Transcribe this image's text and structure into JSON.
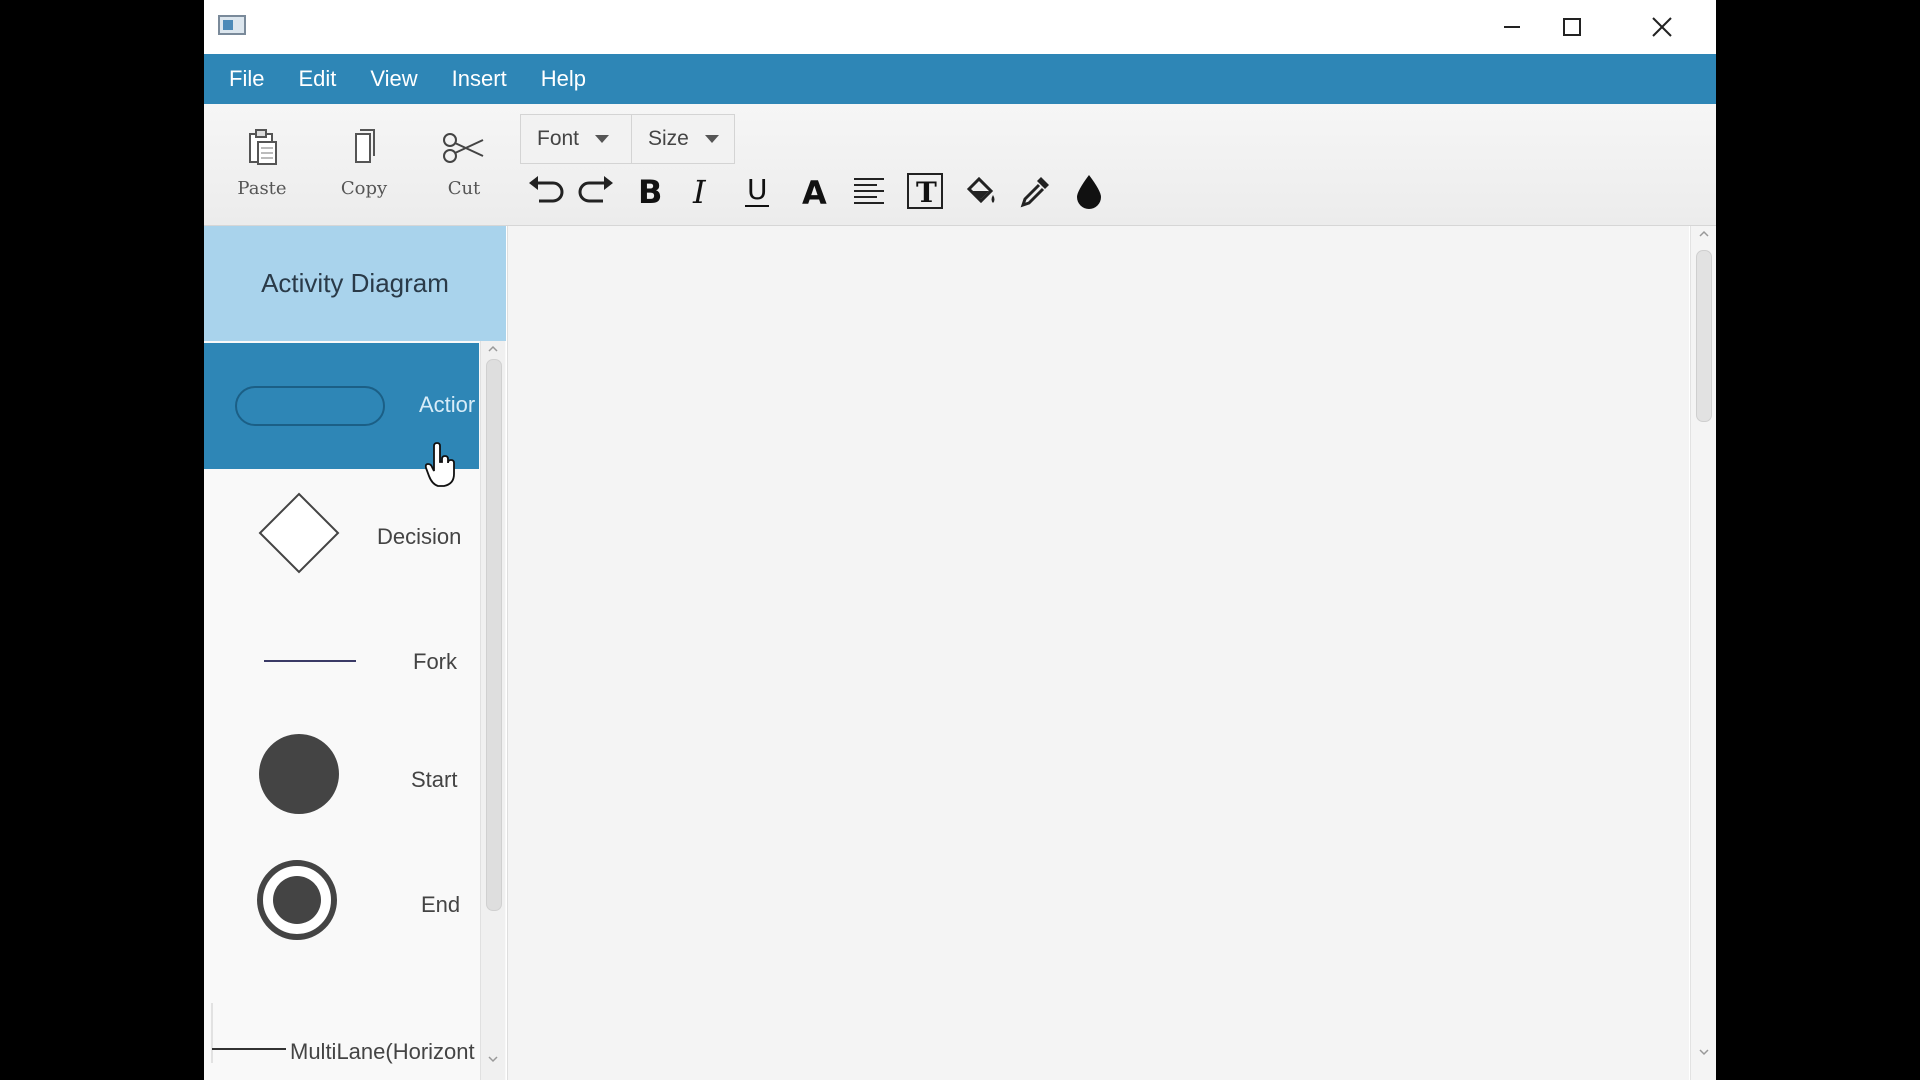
{
  "window": {
    "controls": {
      "minimize": "minimize-icon",
      "maximize": "maximize-icon",
      "close": "close-icon"
    }
  },
  "menu": {
    "items": [
      "File",
      "Edit",
      "View",
      "Insert",
      "Help"
    ]
  },
  "toolbar": {
    "paste_label": "Paste",
    "copy_label": "Copy",
    "cut_label": "Cut",
    "font_dropdown": "Font",
    "size_dropdown": "Size",
    "format_buttons": [
      "undo-icon",
      "redo-icon",
      "bold-icon",
      "italic-icon",
      "underline-icon",
      "font-color-icon",
      "align-icon",
      "text-box-icon",
      "fill-bucket-icon",
      "eyedropper-icon",
      "ink-drop-icon"
    ]
  },
  "palette": {
    "title": "Activity Diagram",
    "items": [
      {
        "label": "Actior",
        "shape": "rounded-rectangle",
        "selected": true
      },
      {
        "label": "Decision",
        "shape": "diamond",
        "selected": false
      },
      {
        "label": "Fork",
        "shape": "line",
        "selected": false
      },
      {
        "label": "Start",
        "shape": "filled-circle",
        "selected": false
      },
      {
        "label": "End",
        "shape": "bullseye",
        "selected": false
      },
      {
        "label": "MultiLane(Horizont",
        "shape": "lane",
        "selected": false
      }
    ]
  },
  "colors": {
    "menu_bar": "#2e86b6",
    "palette_header": "#a9d3ec",
    "selected_item": "#2e86b6",
    "canvas": "#f4f4f4"
  }
}
